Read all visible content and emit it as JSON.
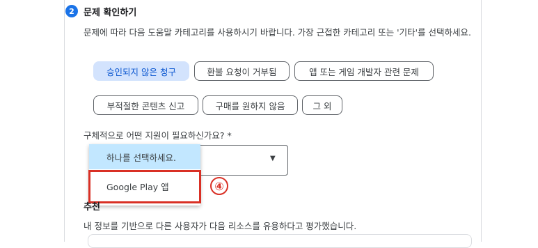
{
  "step": {
    "number": "2",
    "title": "문제 확인하기",
    "description": "문제에 따라 다음 도움말 카테고리를 사용하시기 바랍니다. 가장 근접한 카테고리 또는 '기타'를 선택하세요."
  },
  "categories": [
    {
      "label": "승인되지 않은 청구",
      "selected": true
    },
    {
      "label": "환불 요청이 거부됨",
      "selected": false
    },
    {
      "label": "앱 또는 게임 개발자 관련 문제",
      "selected": false
    },
    {
      "label": "부적절한 콘텐츠 신고",
      "selected": false
    },
    {
      "label": "구매를 원하지 않음",
      "selected": false
    },
    {
      "label": "그 외",
      "selected": false
    }
  ],
  "support_question": "구체적으로 어떤 지원이 필요하신가요? *",
  "dropdown": {
    "options": [
      "하나를 선택하세요.",
      "Google Play 앱"
    ],
    "highlighted_index": 0
  },
  "annotation": {
    "marker": "④",
    "color": "#d93025"
  },
  "recommendation": {
    "title": "추천",
    "description": "내 정보를 기반으로 다른 사용자가 다음 리소스를 유용하다고 평가했습니다."
  },
  "colors": {
    "accent": "#1a73e8",
    "selected_chip_bg": "#d3e3fd",
    "dropdown_highlight": "#c2e7ff"
  }
}
